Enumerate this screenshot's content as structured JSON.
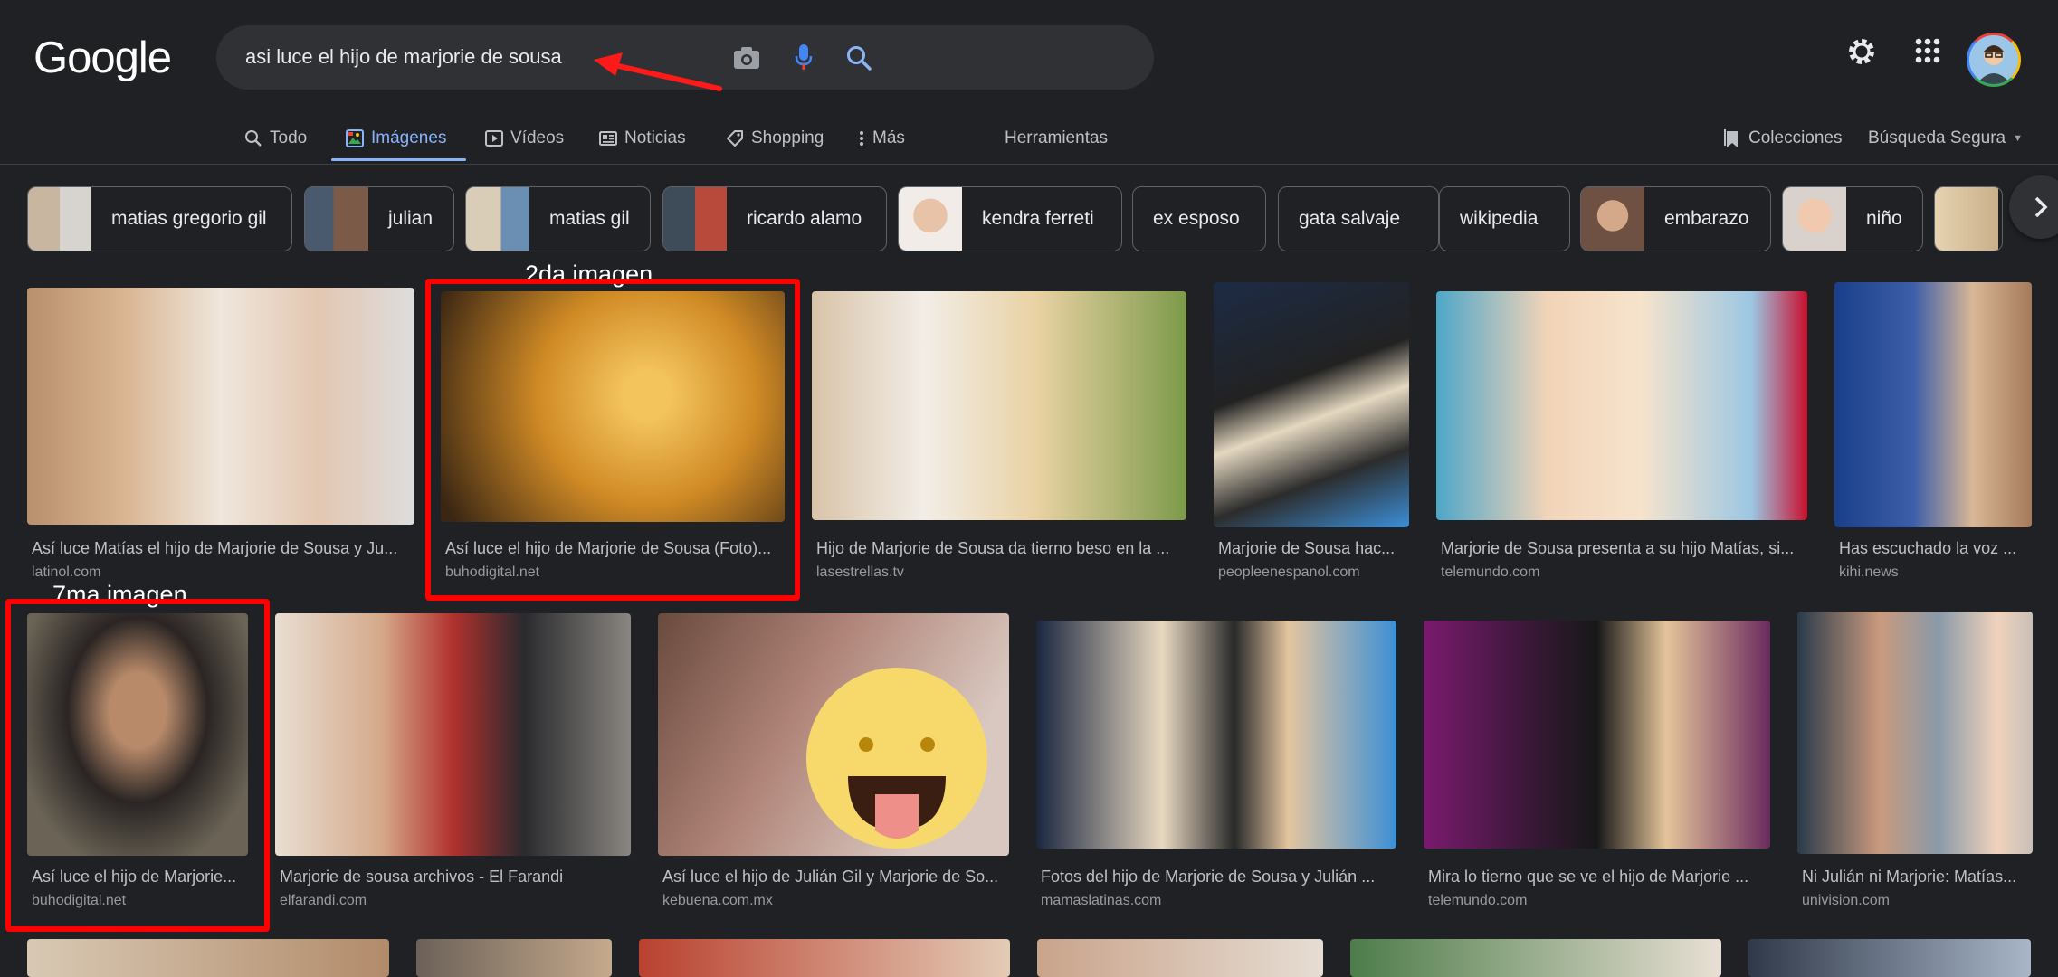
{
  "logo": "Google",
  "search": {
    "query": "asi luce el hijo de marjorie de sousa"
  },
  "icons": {
    "camera": "camera-icon",
    "mic": "mic-icon",
    "search": "search-icon",
    "settings": "gear-icon",
    "apps": "apps-grid-icon",
    "avatar": "avatar"
  },
  "tabs": [
    {
      "label": "Todo",
      "icon": "search-icon"
    },
    {
      "label": "Imágenes",
      "icon": "image-icon"
    },
    {
      "label": "Vídeos",
      "icon": "video-icon"
    },
    {
      "label": "Noticias",
      "icon": "news-icon"
    },
    {
      "label": "Shopping",
      "icon": "tag-icon"
    },
    {
      "label": "Más",
      "icon": "more-vert-icon"
    }
  ],
  "tools_label": "Herramientas",
  "collections_label": "Colecciones",
  "safesearch_label": "Búsqueda Segura",
  "chips": [
    "matias gregorio gil",
    "julian",
    "matias gil",
    "ricardo alamo",
    "kendra ferreti",
    "ex esposo",
    "gata salvaje",
    "wikipedia",
    "embarazo",
    "niño"
  ],
  "results_row1": [
    {
      "title": "Así luce Matías el hijo de Marjorie de Sousa y Ju...",
      "site": "latinol.com"
    },
    {
      "title": "Así luce el hijo de Marjorie de Sousa (Foto)...",
      "site": "buhodigital.net"
    },
    {
      "title": "Hijo de Marjorie de Sousa da tierno beso en la ...",
      "site": "lasestrellas.tv"
    },
    {
      "title": "Marjorie de Sousa hac...",
      "site": "peopleenespanol.com"
    },
    {
      "title": "Marjorie de Sousa presenta a su hijo Matías, si...",
      "site": "telemundo.com"
    },
    {
      "title": "Has escuchado la voz ...",
      "site": "kihi.news"
    }
  ],
  "results_row2": [
    {
      "title": "Así luce el hijo de Marjorie...",
      "site": "buhodigital.net"
    },
    {
      "title": "Marjorie de sousa archivos - El Farandi",
      "site": "elfarandi.com"
    },
    {
      "title": "Así luce el hijo de Julián Gil y Marjorie de So...",
      "site": "kebuena.com.mx"
    },
    {
      "title": "Fotos del hijo de Marjorie de Sousa y Julián ...",
      "site": "mamaslatinas.com"
    },
    {
      "title": "Mira lo tierno que se ve el hijo de Marjorie ...",
      "site": "telemundo.com"
    },
    {
      "title": "Ni Julián ni Marjorie: Matías...",
      "site": "univision.com"
    }
  ],
  "annotations": {
    "second": "2da imagen",
    "seventh": "7ma imagen"
  },
  "colors": {
    "background": "#202124",
    "accent": "#8ab4f8",
    "highlight": "#ff0000"
  }
}
